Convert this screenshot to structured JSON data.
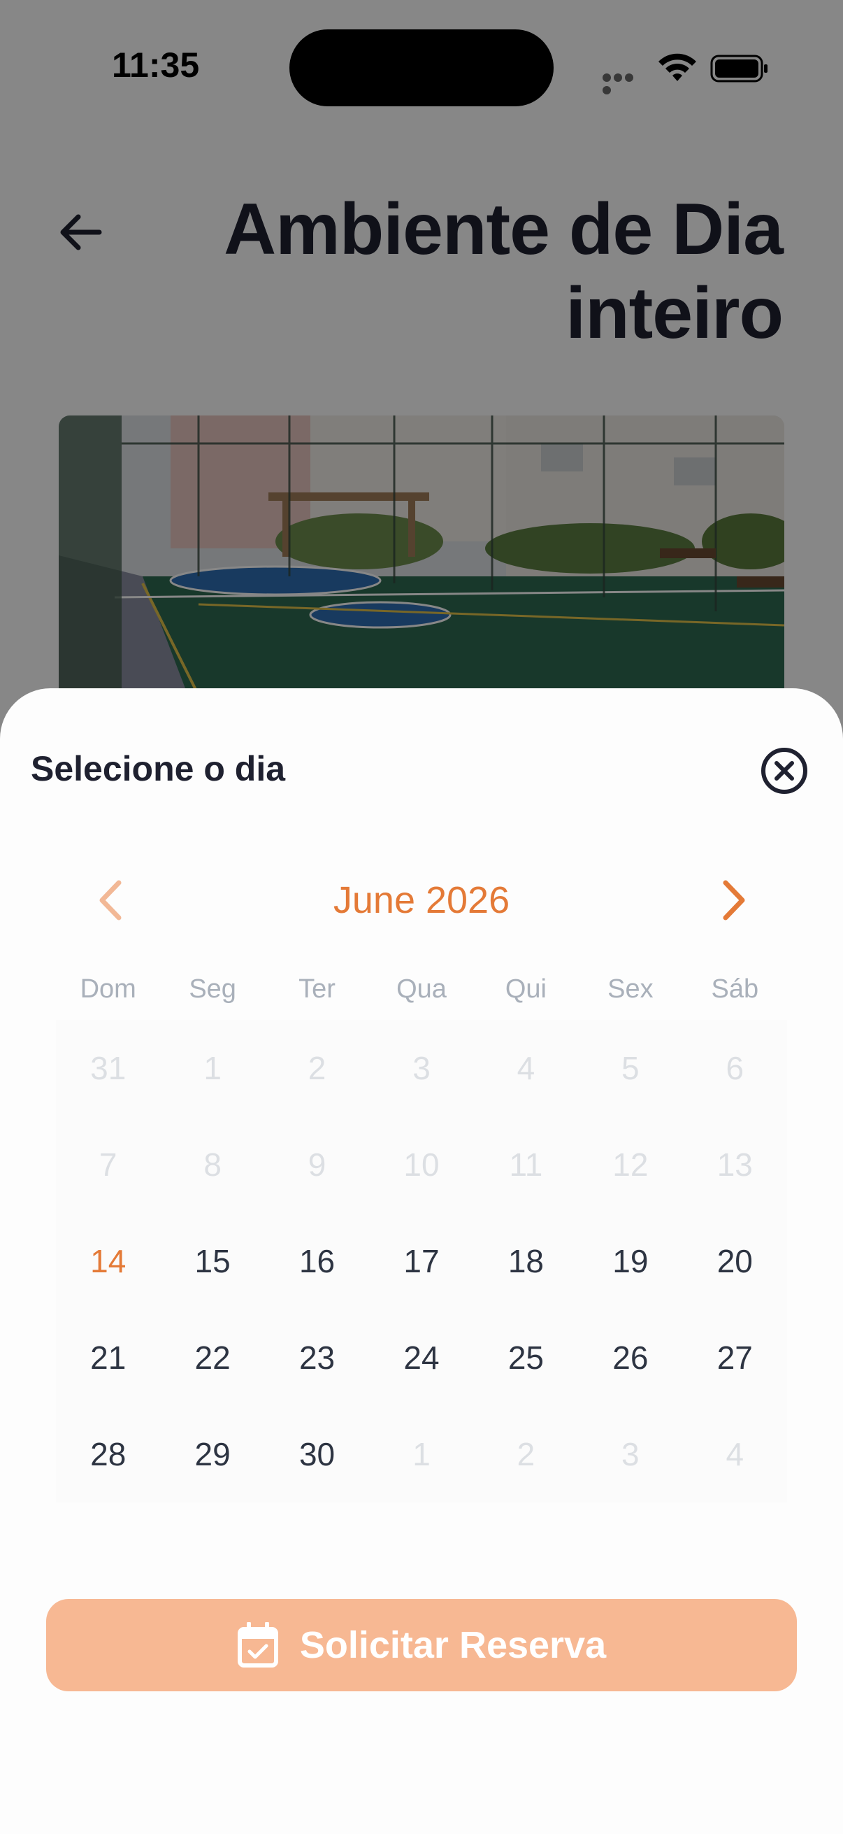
{
  "status_bar": {
    "time": "11:35"
  },
  "header": {
    "title": "Ambiente de Dia inteiro"
  },
  "sheet": {
    "title": "Selecione o dia",
    "month_label": "June 2026",
    "weekdays": [
      "Dom",
      "Seg",
      "Ter",
      "Qua",
      "Qui",
      "Sex",
      "Sáb"
    ],
    "weeks": [
      [
        {
          "label": "31",
          "state": "muted"
        },
        {
          "label": "1",
          "state": "muted"
        },
        {
          "label": "2",
          "state": "muted"
        },
        {
          "label": "3",
          "state": "muted"
        },
        {
          "label": "4",
          "state": "muted"
        },
        {
          "label": "5",
          "state": "muted"
        },
        {
          "label": "6",
          "state": "muted"
        }
      ],
      [
        {
          "label": "7",
          "state": "muted"
        },
        {
          "label": "8",
          "state": "muted"
        },
        {
          "label": "9",
          "state": "muted"
        },
        {
          "label": "10",
          "state": "muted"
        },
        {
          "label": "11",
          "state": "muted"
        },
        {
          "label": "12",
          "state": "muted"
        },
        {
          "label": "13",
          "state": "muted"
        }
      ],
      [
        {
          "label": "14",
          "state": "today"
        },
        {
          "label": "15",
          "state": "available"
        },
        {
          "label": "16",
          "state": "available"
        },
        {
          "label": "17",
          "state": "available"
        },
        {
          "label": "18",
          "state": "available"
        },
        {
          "label": "19",
          "state": "available"
        },
        {
          "label": "20",
          "state": "available"
        }
      ],
      [
        {
          "label": "21",
          "state": "available"
        },
        {
          "label": "22",
          "state": "available"
        },
        {
          "label": "23",
          "state": "available"
        },
        {
          "label": "24",
          "state": "available"
        },
        {
          "label": "25",
          "state": "available"
        },
        {
          "label": "26",
          "state": "available"
        },
        {
          "label": "27",
          "state": "available"
        }
      ],
      [
        {
          "label": "28",
          "state": "available"
        },
        {
          "label": "29",
          "state": "available"
        },
        {
          "label": "30",
          "state": "available"
        },
        {
          "label": "1",
          "state": "muted"
        },
        {
          "label": "2",
          "state": "muted"
        },
        {
          "label": "3",
          "state": "muted"
        },
        {
          "label": "4",
          "state": "muted"
        }
      ]
    ],
    "reserve_button_label": "Solicitar Reserva"
  },
  "colors": {
    "accent": "#e47a37",
    "button_bg": "#f7b893",
    "text_dark": "#1f2130",
    "muted_day": "#dcdfe3",
    "weekday_label": "#a9b0ba"
  },
  "icons": [
    "back-arrow-icon",
    "close-icon",
    "chevron-left-icon",
    "chevron-right-icon",
    "calendar-check-icon",
    "wifi-icon",
    "battery-icon"
  ]
}
